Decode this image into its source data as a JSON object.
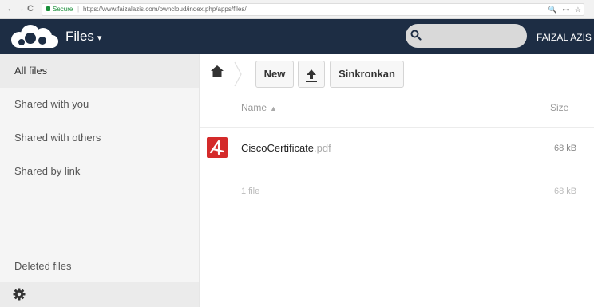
{
  "browser": {
    "back": "←",
    "forward": "→",
    "reload": "C",
    "secure": "Secure",
    "separator": "|",
    "url": "https://www.faizalazis.com/owncloud/index.php/apps/files/",
    "right_icons": "🔍 ⊶ ☆"
  },
  "header": {
    "app_title": "Files",
    "caret": "▾",
    "user": "FAIZAL AZIS"
  },
  "sidebar": {
    "items": [
      {
        "label": "All files"
      },
      {
        "label": "Shared with you"
      },
      {
        "label": "Shared with others"
      },
      {
        "label": "Shared by link"
      }
    ],
    "deleted": "Deleted files"
  },
  "controls": {
    "new_label": "New",
    "sync_label": "Sinkronkan"
  },
  "table": {
    "columns": {
      "name": "Name",
      "sort": "▲",
      "size": "Size"
    },
    "files": [
      {
        "name": "CiscoCertificate",
        "ext": ".pdf",
        "size": "68 kB"
      }
    ],
    "summary": {
      "count": "1 file",
      "size": "68 kB"
    }
  },
  "colors": {
    "header_bg": "#1d2d44",
    "sidebar_bg": "#f5f5f5",
    "active_item_bg": "#ebebeb",
    "pdf_icon": "#d42a2a"
  },
  "icons": [
    "cloud-logo-icon",
    "search-icon",
    "home-icon",
    "upload-icon",
    "gear-icon",
    "pdf-file-icon",
    "lock-icon"
  ]
}
